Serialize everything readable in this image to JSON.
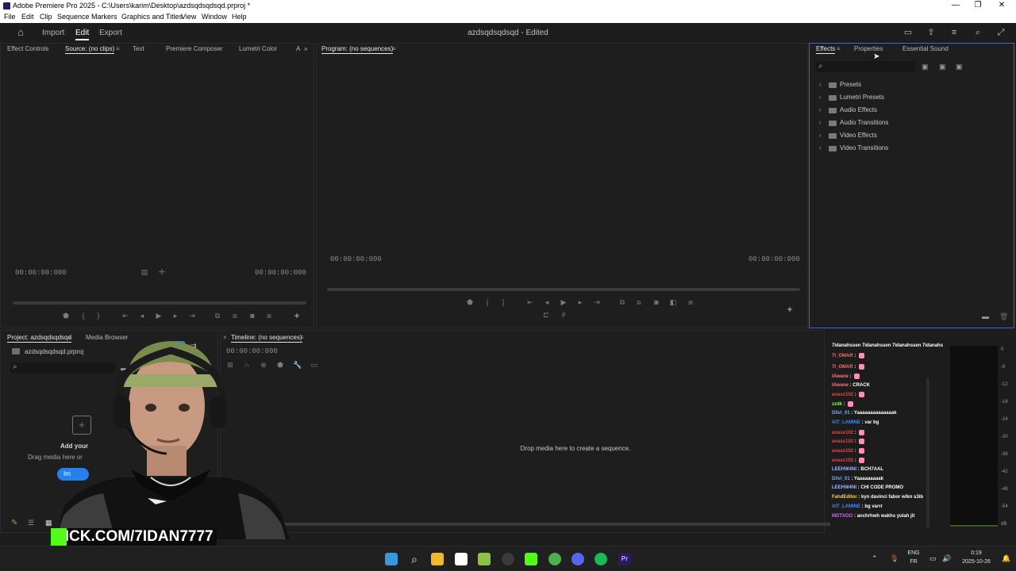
{
  "window": {
    "title": "Adobe Premiere Pro 2025 - C:\\Users\\karim\\Desktop\\azdsqdsqdsqd.prproj *",
    "minimize": "—",
    "maximize": "❐",
    "close": "✕"
  },
  "menu": [
    "File",
    "Edit",
    "Clip",
    "Sequence",
    "Markers",
    "Graphics and Titles",
    "View",
    "Window",
    "Help"
  ],
  "header": {
    "nav": [
      "Import",
      "Edit",
      "Export"
    ],
    "active_nav": "Edit",
    "doc_title": "azdsqdsqdsqd - Edited"
  },
  "source_panel": {
    "tabs": [
      "Effect Controls",
      "Source: (no clips)",
      "Text",
      "Premiere Composer",
      "Lumetri Color",
      "A"
    ],
    "timecode_left": "00:00:00:000",
    "timecode_right": "00:00:00:000"
  },
  "program_panel": {
    "tab": "Program: (no sequences)",
    "timecode_left": "00:00:00:000",
    "timecode_right": "00:00:00:000"
  },
  "effects_panel": {
    "tabs": [
      "Effects",
      "Properties",
      "Essential Sound"
    ],
    "search_placeholder": "",
    "items": [
      "Presets",
      "Lumetri Presets",
      "Audio Effects",
      "Audio Transitions",
      "Video Effects",
      "Video Transitions"
    ]
  },
  "project_panel": {
    "tabs": [
      "Project: azdsqdsqdsqd",
      "Media Browser"
    ],
    "file": "azdsqdsqdsqd.prproj",
    "import_title": "Add your",
    "import_hint": "Drag media here or",
    "import_button": "Im"
  },
  "timeline_panel": {
    "tab": "Timeline: (no sequences)",
    "timecode": "00:00:00:000",
    "drop_hint": "Drop media here to create a sequence."
  },
  "chat": {
    "header": "7idanahssen 7idanahssen 7idanahssen 7idanahssen 7idan",
    "lines": [
      {
        "user": "7I_OMAR",
        "text": "",
        "color": "#ff6b6b",
        "emote": true
      },
      {
        "user": "7I_OMAR",
        "text": "",
        "color": "#ff6b6b",
        "emote": true
      },
      {
        "user": "IAwane",
        "text": "",
        "color": "#ff7a7a",
        "emote": true
      },
      {
        "user": "IAwane",
        "text": "CRACK",
        "color": "#ff7a7a",
        "emote": false
      },
      {
        "user": "anasx102",
        "text": "",
        "color": "#e04848",
        "emote": true
      },
      {
        "user": "zzdk",
        "text": "",
        "color": "#7cff6b",
        "emote": true
      },
      {
        "user": "Dilvi_01",
        "text": "Yaaaaaaaaaaaaaak",
        "color": "#7aa8ff",
        "emote": false
      },
      {
        "user": "AIT_LAMINE",
        "text": "var bg",
        "color": "#3a8bff",
        "emote": false
      },
      {
        "user": "anasx102",
        "text": "",
        "color": "#e04848",
        "emote": true
      },
      {
        "user": "anasx102",
        "text": "",
        "color": "#e04848",
        "emote": true
      },
      {
        "user": "anasx102",
        "text": "",
        "color": "#e04848",
        "emote": true
      },
      {
        "user": "anasx102",
        "text": "",
        "color": "#e04848",
        "emote": true
      },
      {
        "user": "LEEHW4NI",
        "text": "BCH7AAL",
        "color": "#9fb8ff",
        "emote": false
      },
      {
        "user": "Dilvi_01",
        "text": "Yaaaaaaaaak",
        "color": "#7aa8ff",
        "emote": false
      },
      {
        "user": "LEEHW4NI",
        "text": "CHI CODE PROMO",
        "color": "#9fb8ff",
        "emote": false
      },
      {
        "user": "FahdEditor",
        "text": "kyn davinci fabor wlkn s3ib",
        "color": "#ffd24a",
        "emote": false
      },
      {
        "user": "AIT_LAMINE",
        "text": "bg varrr",
        "color": "#3a8bff",
        "emote": false
      },
      {
        "user": "MDTXOO",
        "text": "anchrhwh wakhs yulah jit",
        "color": "#c86bff",
        "emote": false
      }
    ]
  },
  "vu_scale": [
    "0",
    "-6",
    "-12",
    "-18",
    "-24",
    "-30",
    "-36",
    "-42",
    "-48",
    "-54",
    "dB"
  ],
  "overlay": {
    "stream_url": "KICK.COM/7IDAN7777"
  },
  "taskbar": {
    "language": "ENG",
    "region": "FR",
    "time": "0:19",
    "date": "2025-10-26"
  },
  "colors": {
    "accent_blue": "#2680eb",
    "kick_green": "#53fc18",
    "bg": "#1d1d1d"
  }
}
